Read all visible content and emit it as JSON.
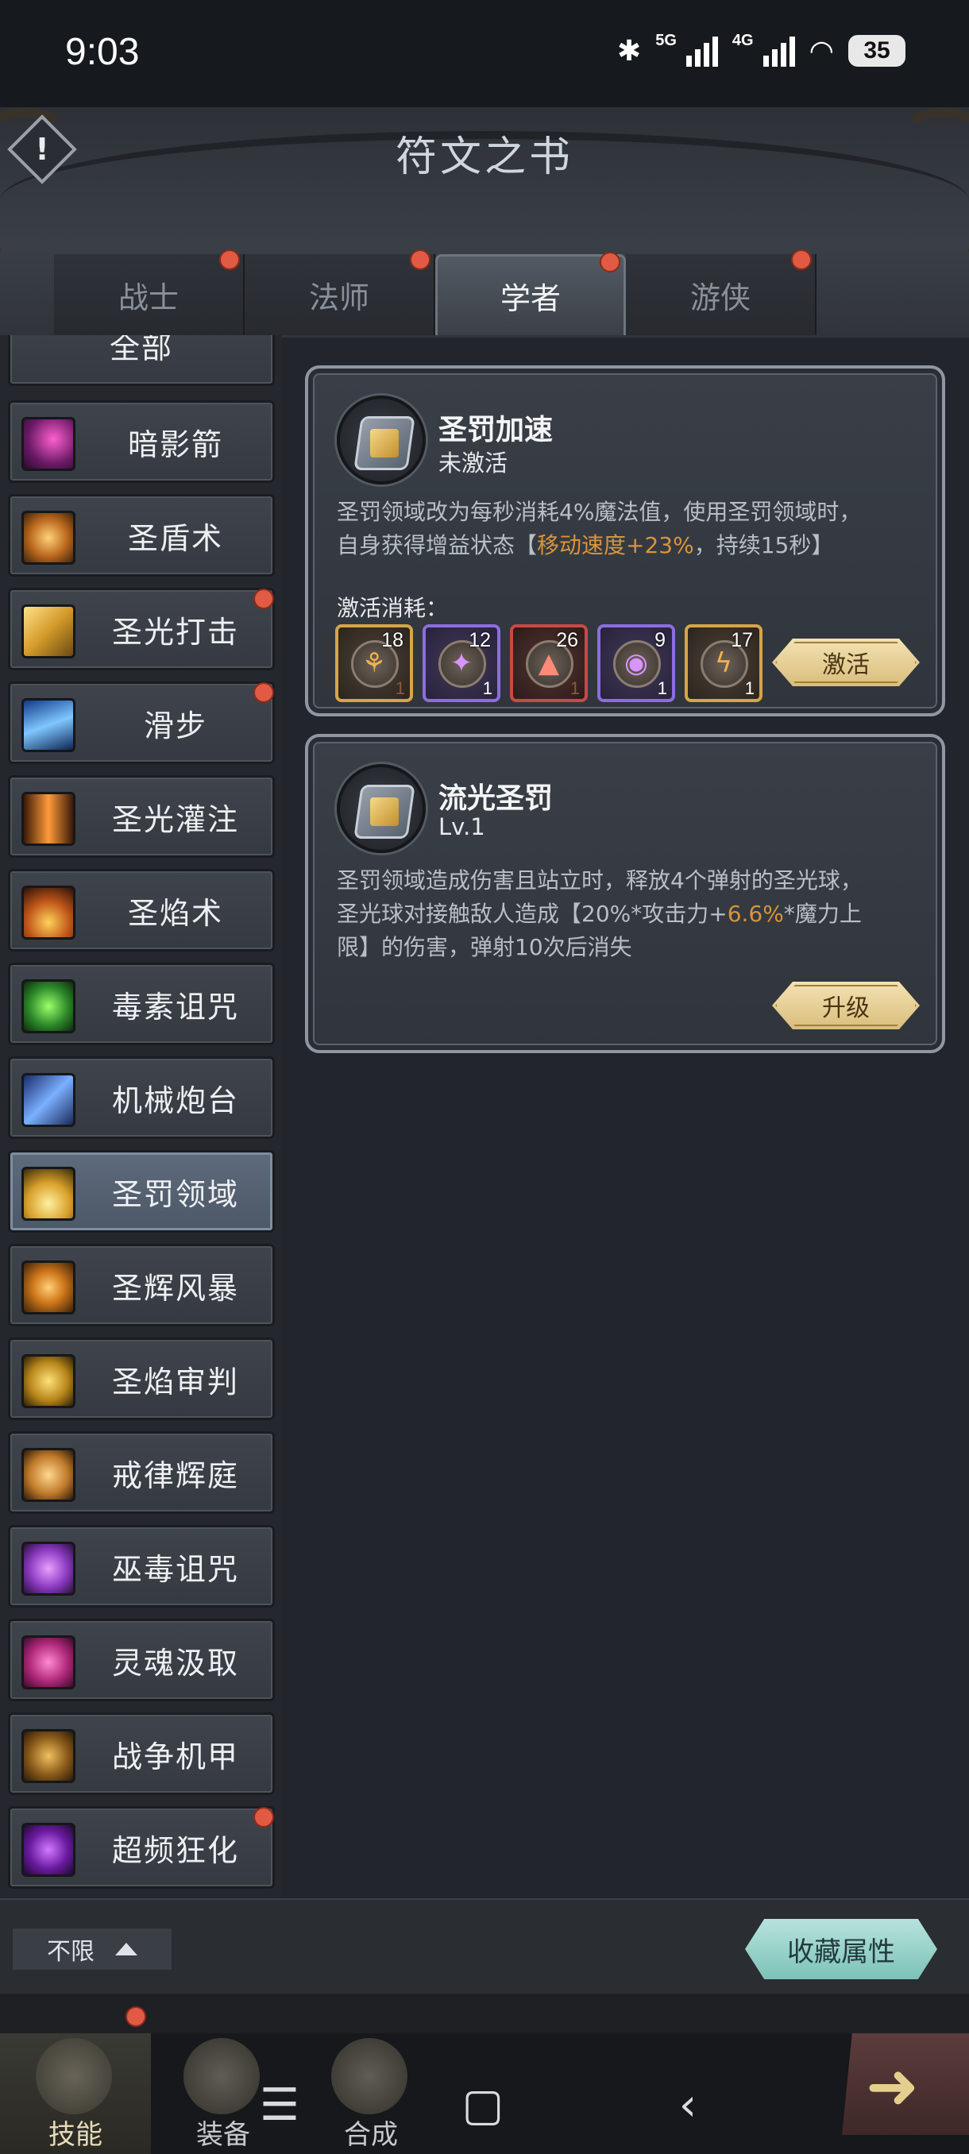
{
  "status_bar": {
    "time": "9:03",
    "signal1": "5G",
    "signal2": "4G",
    "battery": "35"
  },
  "header": {
    "title": "符文之书",
    "info_label": "!"
  },
  "tabs": [
    {
      "label": "战士",
      "active": false
    },
    {
      "label": "法师",
      "active": false
    },
    {
      "label": "学者",
      "active": true
    },
    {
      "label": "游侠",
      "active": false
    }
  ],
  "skills": [
    {
      "label": "全部",
      "icon": "all-icon"
    },
    {
      "label": "暗影箭",
      "icon": "shadow-arrow-icon"
    },
    {
      "label": "圣盾术",
      "icon": "holy-shield-icon"
    },
    {
      "label": "圣光打击",
      "icon": "holy-strike-icon",
      "badge": true
    },
    {
      "label": "滑步",
      "icon": "slide-step-icon",
      "badge": true
    },
    {
      "label": "圣光灌注",
      "icon": "holy-infusion-icon"
    },
    {
      "label": "圣焰术",
      "icon": "holy-flame-icon"
    },
    {
      "label": "毒素诅咒",
      "icon": "poison-curse-icon"
    },
    {
      "label": "机械炮台",
      "icon": "turret-icon"
    },
    {
      "label": "圣罚领域",
      "icon": "holy-domain-icon",
      "active": true
    },
    {
      "label": "圣辉风暴",
      "icon": "holy-storm-icon"
    },
    {
      "label": "圣焰审判",
      "icon": "holy-judgment-icon"
    },
    {
      "label": "戒律辉庭",
      "icon": "discipline-court-icon"
    },
    {
      "label": "巫毒诅咒",
      "icon": "voodoo-curse-icon"
    },
    {
      "label": "灵魂汲取",
      "icon": "soul-drain-icon"
    },
    {
      "label": "战争机甲",
      "icon": "war-mech-icon"
    },
    {
      "label": "超频狂化",
      "icon": "overclock-rage-icon",
      "badge": true
    }
  ],
  "card1": {
    "title": "圣罚加速",
    "status": "未激活",
    "desc_line1": "圣罚领域改为每秒消耗4%魔法值，使用圣罚领域时，",
    "desc_line2_a": "自身获得增益状态【",
    "desc_line2_hl": "移动速度+23%",
    "desc_line2_b": "，持续15秒】",
    "cost_label": "激活消耗：",
    "runes": [
      {
        "count": "18",
        "level": "1",
        "style": "gold",
        "glyph": "⚘"
      },
      {
        "count": "12",
        "level": "1",
        "style": "purple",
        "glyph": "✦"
      },
      {
        "count": "26",
        "level": "1",
        "style": "red",
        "glyph": "▲"
      },
      {
        "count": "9",
        "level": "1",
        "style": "purple",
        "glyph": "◉"
      },
      {
        "count": "17",
        "level": "1",
        "style": "gold",
        "glyph": "ϟ"
      }
    ],
    "action": "激活"
  },
  "card2": {
    "title": "流光圣罚",
    "level": "Lv.1",
    "desc_line1": "圣罚领域造成伤害且站立时，释放4个弹射的圣光球，",
    "desc_line2_a": "圣光球对接触敌人造成【20%*攻击力+",
    "desc_line2_hl": "6.6%",
    "desc_line2_b": "*魔力上",
    "desc_line3": "限】的伤害，弹射10次后消失",
    "action": "升级"
  },
  "filter": {
    "label": "不限"
  },
  "favorite_button": "收藏属性",
  "bottom_nav": [
    {
      "label": "技能",
      "active": true
    },
    {
      "label": "装备",
      "active": false
    },
    {
      "label": "合成",
      "active": false
    }
  ],
  "sys_nav": {
    "menu": "☰",
    "home": "▢",
    "back": "‹"
  },
  "colors": {
    "highlight": "#d8943c",
    "badge": "#e05a44",
    "gold_button": "#e8d199",
    "teal_button": "#9fd4cc"
  }
}
